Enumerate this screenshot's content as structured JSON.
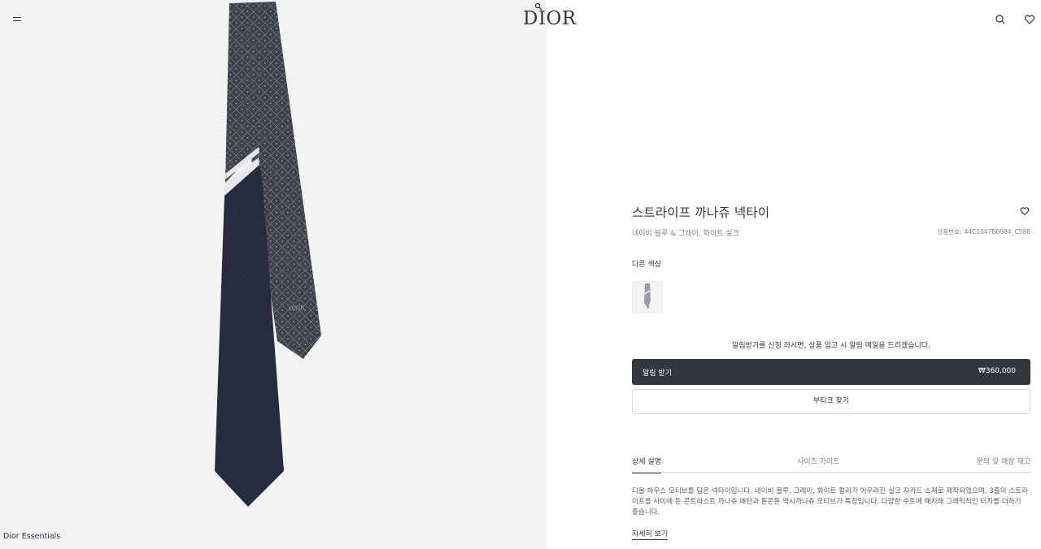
{
  "header": {
    "logo": "DIOR",
    "menu_icon": "menu-icon",
    "search_icon": "search-icon",
    "wishlist_icon": "heart-icon"
  },
  "gallery": {
    "collection_label": "Dior Essentials"
  },
  "product": {
    "title": "스트라이프 까나쥬 넥타이",
    "subtitle": "네이비 블루 & 그레이, 화이트 실크",
    "ref_label": "상품번호:",
    "ref_value": "44C1047B0984_C588",
    "other_colors_label": "다른 색상",
    "notice": "알림받기를 신청 하시면, 상품 입고 시 알림 메일을 드리겠습니다.",
    "alert_button_label": "알림 받기",
    "price": "₩360,000",
    "find_store_label": "부티크 찾기",
    "tabs": [
      {
        "label": "상세 설명"
      },
      {
        "label": "사이즈 가이드"
      },
      {
        "label": "문의 및 매장 재고"
      }
    ],
    "description": "디올 하우스 모티브를 담은 넥타이입니다. 네이비 블루, 그레이, 화이트 컬러가 어우러진 실크 자카드 소재로 제작되었으며, 3줄의 스트라이프를 사이에 둔 콘트라스트 까나쥬 패턴과 톤온톤 맥시까나쥬 모티브가 특징입니다. 다양한 수트에 매치해 그래픽적인 터치를 더하기 좋습니다.",
    "read_more_label": "자세히 보기"
  },
  "colors": {
    "accent": "#33383c",
    "tie_navy": "#252a3e",
    "tie_pattern": "#42464f"
  }
}
